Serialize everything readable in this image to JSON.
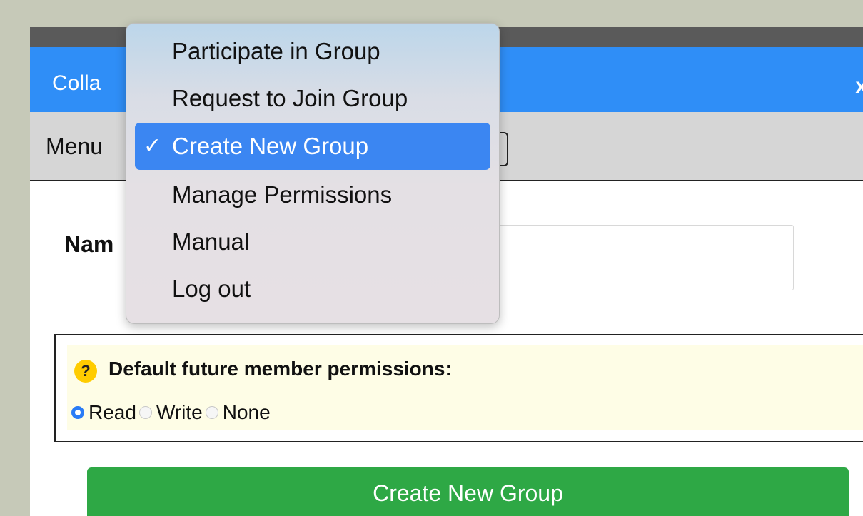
{
  "window": {
    "title": "Colla",
    "close_icon": "x"
  },
  "menubar": {
    "label": "Menu"
  },
  "dropdown": {
    "items": [
      {
        "label": "Participate in Group",
        "selected": false
      },
      {
        "label": "Request to Join Group",
        "selected": false
      },
      {
        "label": "Create New Group",
        "selected": true
      },
      {
        "label": "Manage Permissions",
        "selected": false
      },
      {
        "label": "Manual",
        "selected": false
      },
      {
        "label": "Log out",
        "selected": false
      }
    ],
    "check_glyph": "✓"
  },
  "form": {
    "name_label": "Nam",
    "name_value": ""
  },
  "permissions": {
    "help_glyph": "?",
    "title": "Default future member permissions:",
    "options": [
      {
        "label": "Read",
        "checked": true
      },
      {
        "label": "Write",
        "checked": false
      },
      {
        "label": "None",
        "checked": false
      }
    ]
  },
  "create_button": {
    "label": "Create New Group"
  },
  "colors": {
    "titlebar": "#2f8ef7",
    "button": "#2ea845",
    "selected_item": "#3b86f2",
    "help": "#ffcc00"
  }
}
